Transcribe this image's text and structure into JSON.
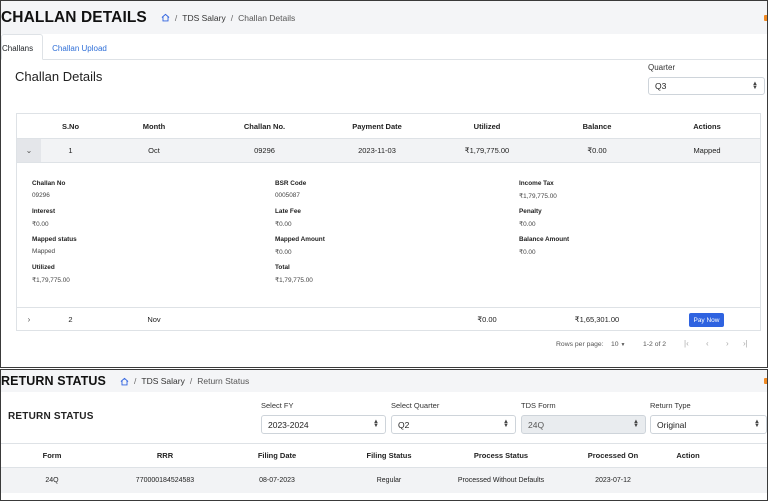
{
  "challan": {
    "title": "CHALLAN DETAILS",
    "breadcrumb": {
      "section": "TDS Salary",
      "current": "Challan Details",
      "separator": "/"
    },
    "tabs": [
      {
        "label": "Challans",
        "active": true
      },
      {
        "label": "Challan Upload",
        "active": false
      }
    ],
    "panel_title": "Challan Details",
    "quarter": {
      "label": "Quarter",
      "value": "Q3"
    },
    "columns": [
      "S.No",
      "Month",
      "Challan No.",
      "Payment Date",
      "Utilized",
      "Balance",
      "Actions"
    ],
    "rows": [
      {
        "sno": "1",
        "month": "Oct",
        "challan_no": "09296",
        "payment_date": "2023-11-03",
        "utilized": "₹1,79,775.00",
        "balance": "₹0.00",
        "action": "Mapped",
        "expanded": true
      },
      {
        "sno": "2",
        "month": "Nov",
        "challan_no": "",
        "payment_date": "",
        "utilized": "₹0.00",
        "balance": "₹1,65,301.00",
        "action": "Pay Now",
        "expanded": false
      }
    ],
    "details": {
      "challan_no_label": "Challan No",
      "challan_no": "09296",
      "bsr_label": "BSR Code",
      "bsr": "0005087",
      "income_tax_label": "Income Tax",
      "income_tax": "₹1,79,775.00",
      "interest_label": "Interest",
      "interest": "₹0.00",
      "late_fee_label": "Late Fee",
      "late_fee": "₹0.00",
      "penalty_label": "Penalty",
      "penalty": "₹0.00",
      "mapped_status_label": "Mapped status",
      "mapped_status": "Mapped",
      "mapped_amount_label": "Mapped Amount",
      "mapped_amount": "₹0.00",
      "balance_amount_label": "Balance Amount",
      "balance_amount": "₹0.00",
      "utilized_label": "Utilized",
      "utilized": "₹1,79,775.00",
      "total_label": "Total",
      "total": "₹1,79,775.00"
    },
    "pagination": {
      "rows_label": "Rows per page:",
      "rows_value": "10",
      "range": "1-2 of 2"
    }
  },
  "return_status": {
    "title": "RETURN STATUS",
    "breadcrumb": {
      "section": "TDS Salary",
      "current": "Return Status",
      "separator": "/"
    },
    "subtitle": "RETURN STATUS",
    "filters": {
      "fy": {
        "label": "Select FY",
        "value": "2023-2024"
      },
      "quarter": {
        "label": "Select Quarter",
        "value": "Q2"
      },
      "form": {
        "label": "TDS Form",
        "value": "24Q"
      },
      "type": {
        "label": "Return Type",
        "value": "Original"
      }
    },
    "columns": [
      "Form",
      "RRR",
      "Filing Date",
      "Filing Status",
      "Process Status",
      "Processed On",
      "Action"
    ],
    "row": {
      "form": "24Q",
      "rrr": "770000184524583",
      "filing_date": "08-07-2023",
      "filing_status": "Regular",
      "process_status": "Processed Without Defaults",
      "processed_on": "2023-07-12",
      "action": ""
    }
  },
  "colors": {
    "accent": "#f08a24",
    "primary": "#2f63e0",
    "link": "#2f6fd8"
  }
}
